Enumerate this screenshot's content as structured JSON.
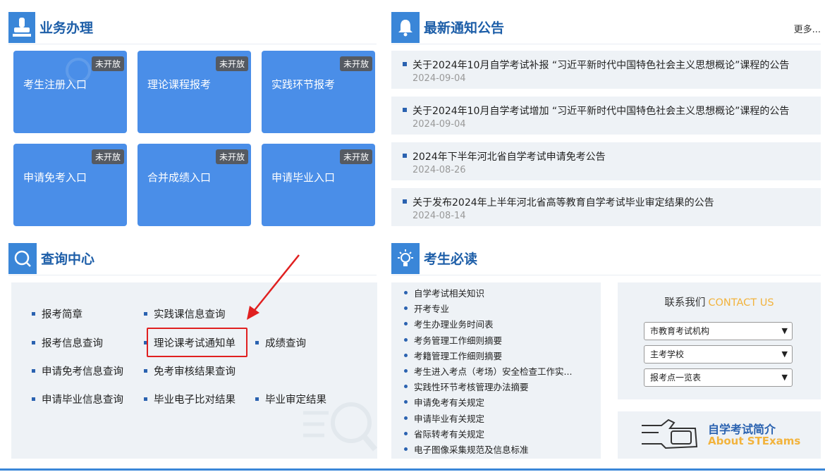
{
  "business": {
    "title": "业务办理",
    "tiles": [
      {
        "label": "考生注册入口",
        "badge": "未开放"
      },
      {
        "label": "理论课程报考",
        "badge": "未开放"
      },
      {
        "label": "实践环节报考",
        "badge": "未开放"
      },
      {
        "label": "申请免考入口",
        "badge": "未开放"
      },
      {
        "label": "合并成绩入口",
        "badge": "未开放"
      },
      {
        "label": "申请毕业入口",
        "badge": "未开放"
      }
    ]
  },
  "notices": {
    "title": "最新通知公告",
    "more": "更多...",
    "items": [
      {
        "title": "关于2024年10月自学考试补报 “习近平新时代中国特色社会主义思想概论”课程的公告",
        "date": "2024-09-04"
      },
      {
        "title": "关于2024年10月自学考试增加 “习近平新时代中国特色社会主义思想概论”课程的公告",
        "date": "2024-09-04"
      },
      {
        "title": "2024年下半年河北省自学考试申请免考公告",
        "date": "2024-08-26"
      },
      {
        "title": "关于发布2024年上半年河北省高等教育自学考试毕业审定结果的公告",
        "date": "2024-08-14"
      }
    ]
  },
  "query": {
    "title": "查询中心",
    "links": {
      "a": "报考简章",
      "b": "实践课信息查询",
      "c": "报考信息查询",
      "d": "理论课考试通知单",
      "e": "成绩查询",
      "f": "申请免考信息查询",
      "g": "免考审核结果查询",
      "h": "申请毕业信息查询",
      "i": "毕业电子比对结果",
      "j": "毕业审定结果"
    }
  },
  "must_read": {
    "title": "考生必读",
    "items": [
      "自学考试相关知识",
      "开考专业",
      "考生办理业务时间表",
      "考务管理工作细则摘要",
      "考籍管理工作细则摘要",
      "考生进入考点（考场）安全检查工作实...",
      "实践性环节考核管理办法摘要",
      "申请免考有关规定",
      "申请毕业有关规定",
      "省际转考有关规定",
      "电子图像采集规范及信息标准"
    ]
  },
  "contact": {
    "title_cn": "联系我们",
    "title_en": "CONTACT US",
    "selects": [
      "市教育考试机构",
      "主考学校",
      "报考点一览表"
    ]
  },
  "intro": {
    "title_cn": "自学考试简介",
    "title_en": "About STExams"
  },
  "colors": {
    "accent": "#3a86d8",
    "tile": "#4a8ee8",
    "panel_bg": "#eef2f6",
    "annotation_red": "#e02020",
    "contact_orange": "#f2b33d"
  }
}
